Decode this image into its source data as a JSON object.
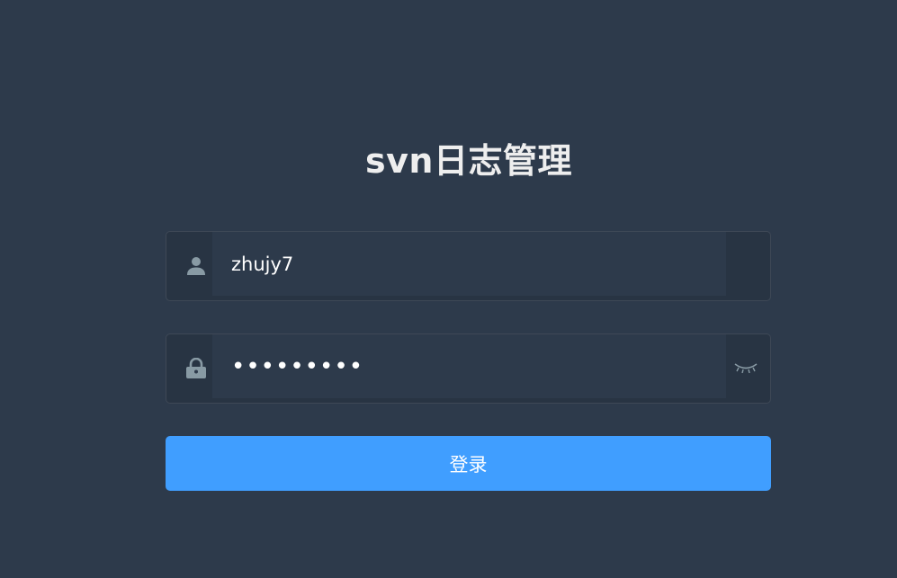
{
  "login": {
    "title": "svn日志管理",
    "username": {
      "value": "zhujy7",
      "icon": "user-icon"
    },
    "password": {
      "value": "•••••••••",
      "icon": "lock-icon",
      "toggle_icon": "eye-closed-icon"
    },
    "submit_label": "登录"
  },
  "colors": {
    "background": "#2d3a4b",
    "title": "#eeeeee",
    "icon": "#889aa4",
    "accent": "#409eff"
  }
}
